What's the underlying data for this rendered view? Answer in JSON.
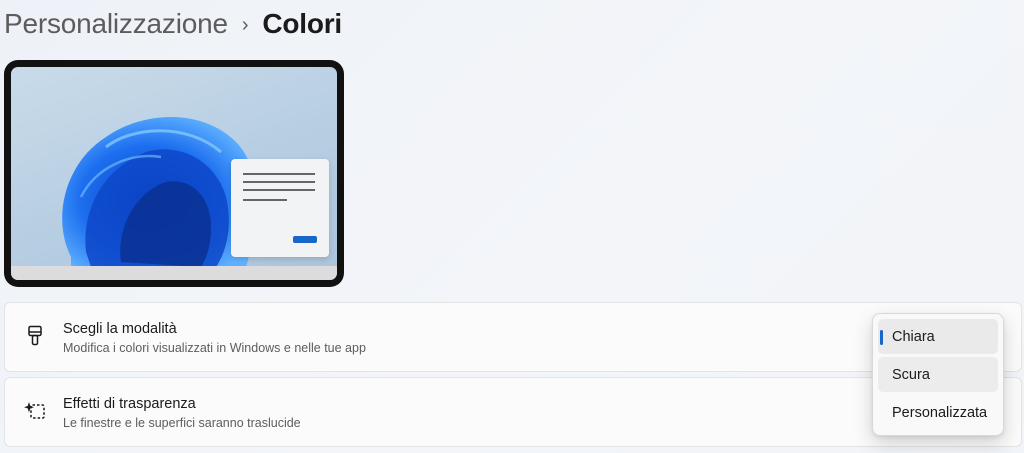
{
  "breadcrumb": {
    "parent": "Personalizzazione",
    "separator": "›",
    "current": "Colori"
  },
  "mode_card": {
    "title": "Scegli la modalità",
    "description": "Modifica i colori visualizzati in Windows e nelle tue app",
    "icon": "paintbrush-icon"
  },
  "transparency_card": {
    "title": "Effetti di trasparenza",
    "description": "Le finestre e le superfici saranno traslucide",
    "icon": "transparency-sparkle-icon"
  },
  "mode_dropdown": {
    "options": [
      "Chiara",
      "Scura",
      "Personalizzata"
    ],
    "selected": "Chiara"
  },
  "colors": {
    "accent": "#1766c9"
  }
}
